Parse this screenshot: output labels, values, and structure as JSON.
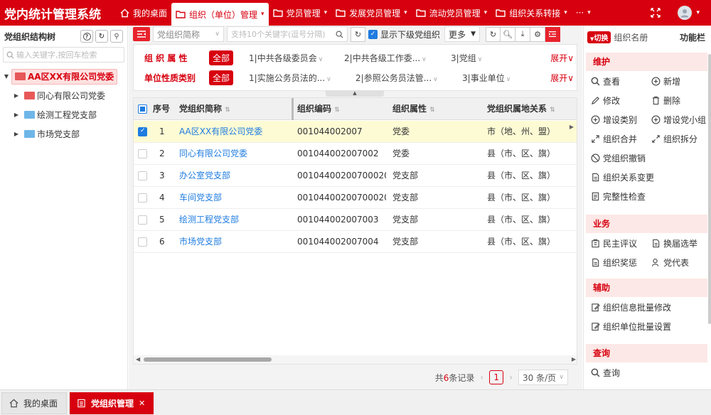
{
  "app": {
    "title": "党内统计管理系统"
  },
  "topnav": [
    {
      "label": "我的桌面",
      "icon": "home-icon",
      "active": false,
      "dropdown": false
    },
    {
      "label": "组织（单位）管理",
      "icon": "folder-icon",
      "active": true,
      "dropdown": true
    },
    {
      "label": "党员管理",
      "icon": "folder-icon",
      "active": false,
      "dropdown": true
    },
    {
      "label": "发展党员管理",
      "icon": "folder-icon",
      "active": false,
      "dropdown": true
    },
    {
      "label": "流动党员管理",
      "icon": "folder-icon",
      "active": false,
      "dropdown": true
    },
    {
      "label": "组织关系转接",
      "icon": "folder-icon",
      "active": false,
      "dropdown": true
    },
    {
      "label": "···",
      "icon": "",
      "active": false,
      "dropdown": true
    }
  ],
  "tree": {
    "title": "党组织结构树",
    "search_placeholder": "输入关键字,按回车检索",
    "nodes": [
      {
        "label": "AA区XX有限公司党委",
        "level": 0,
        "selected": true
      },
      {
        "label": "同心有限公司党委",
        "level": 1,
        "selected": false
      },
      {
        "label": "绘测工程党支部",
        "level": 1,
        "selected": false
      },
      {
        "label": "市场党支部",
        "level": 1,
        "selected": false
      }
    ]
  },
  "toolbar": {
    "field_select": "党组织简称",
    "keyword_placeholder": "支持10个关键字(逗号分隔)",
    "show_sub_label": "显示下级党组织",
    "more_label": "更多"
  },
  "filters": {
    "row1": {
      "label": "组 织 属 性",
      "all": "全部",
      "options": [
        "1|中共各级委员会",
        "2|中共各级工作委...",
        "3|党组"
      ],
      "expand": "展开"
    },
    "row2": {
      "label": "单位性质类别",
      "all": "全部",
      "options": [
        "1|实施公务员法的...",
        "2|参照公务员法管...",
        "3|事业单位"
      ],
      "expand": "展开"
    }
  },
  "table": {
    "headers": [
      "序号",
      "党组织简称",
      "组织编码",
      "组织属性",
      "党组织属地关系"
    ],
    "rows": [
      {
        "no": "1",
        "name": "AA区XX有限公司党委",
        "code": "001044002007",
        "attr": "党委",
        "rel": "市（地、州、盟）",
        "selected": true
      },
      {
        "no": "2",
        "name": "同心有限公司党委",
        "code": "001044002007002",
        "attr": "党委",
        "rel": "县（市、区、旗）",
        "selected": false
      },
      {
        "no": "3",
        "name": "办公室党支部",
        "code": "00104400200700020...",
        "attr": "党支部",
        "rel": "县（市、区、旗）",
        "selected": false
      },
      {
        "no": "4",
        "name": "车间党支部",
        "code": "00104400200700020...",
        "attr": "党支部",
        "rel": "县（市、区、旗）",
        "selected": false
      },
      {
        "no": "5",
        "name": "绘测工程党支部",
        "code": "001044002007003",
        "attr": "党支部",
        "rel": "县（市、区、旗）",
        "selected": false
      },
      {
        "no": "6",
        "name": "市场党支部",
        "code": "001044002007004",
        "attr": "党支部",
        "rel": "县（市、区、旗）",
        "selected": false
      }
    ]
  },
  "pager": {
    "total_prefix": "共",
    "total_count": "6",
    "total_suffix": "条记录",
    "current_page": "1",
    "page_size": "30 条/页"
  },
  "rightpanel": {
    "switch_label": "切换",
    "list_label": "组织名册",
    "title": "功能栏",
    "sections": [
      {
        "title": "维护",
        "actions": [
          {
            "label": "查看",
            "icon": "search-icon"
          },
          {
            "label": "新增",
            "icon": "plus-circle-icon"
          },
          {
            "label": "修改",
            "icon": "edit-icon"
          },
          {
            "label": "删除",
            "icon": "trash-icon"
          },
          {
            "label": "增设类别",
            "icon": "plus-circle-icon"
          },
          {
            "label": "增设党小组",
            "icon": "plus-circle-icon"
          },
          {
            "label": "组织合并",
            "icon": "merge-icon"
          },
          {
            "label": "组织拆分",
            "icon": "split-icon"
          },
          {
            "label": "党组织撤销",
            "icon": "ban-icon"
          },
          {
            "label": "组织关系变更",
            "icon": "doc-icon"
          },
          {
            "label": "完整性检查",
            "icon": "check-doc-icon"
          }
        ]
      },
      {
        "title": "业务",
        "actions": [
          {
            "label": "民主评议",
            "icon": "building-icon"
          },
          {
            "label": "换届选举",
            "icon": "doc-icon"
          },
          {
            "label": "组织奖惩",
            "icon": "doc-icon"
          },
          {
            "label": "党代表",
            "icon": "user-icon"
          }
        ]
      },
      {
        "title": "辅助",
        "actions": [
          {
            "label": "组织信息批量修改",
            "icon": "edit-doc-icon"
          },
          {
            "label": "组织单位批量设置",
            "icon": "edit-doc-icon"
          }
        ]
      },
      {
        "title": "查询",
        "actions": [
          {
            "label": "查询",
            "icon": "search-icon"
          }
        ]
      }
    ]
  },
  "bottom_tabs": [
    {
      "label": "我的桌面",
      "active": false
    },
    {
      "label": "党组织管理",
      "active": true
    }
  ]
}
